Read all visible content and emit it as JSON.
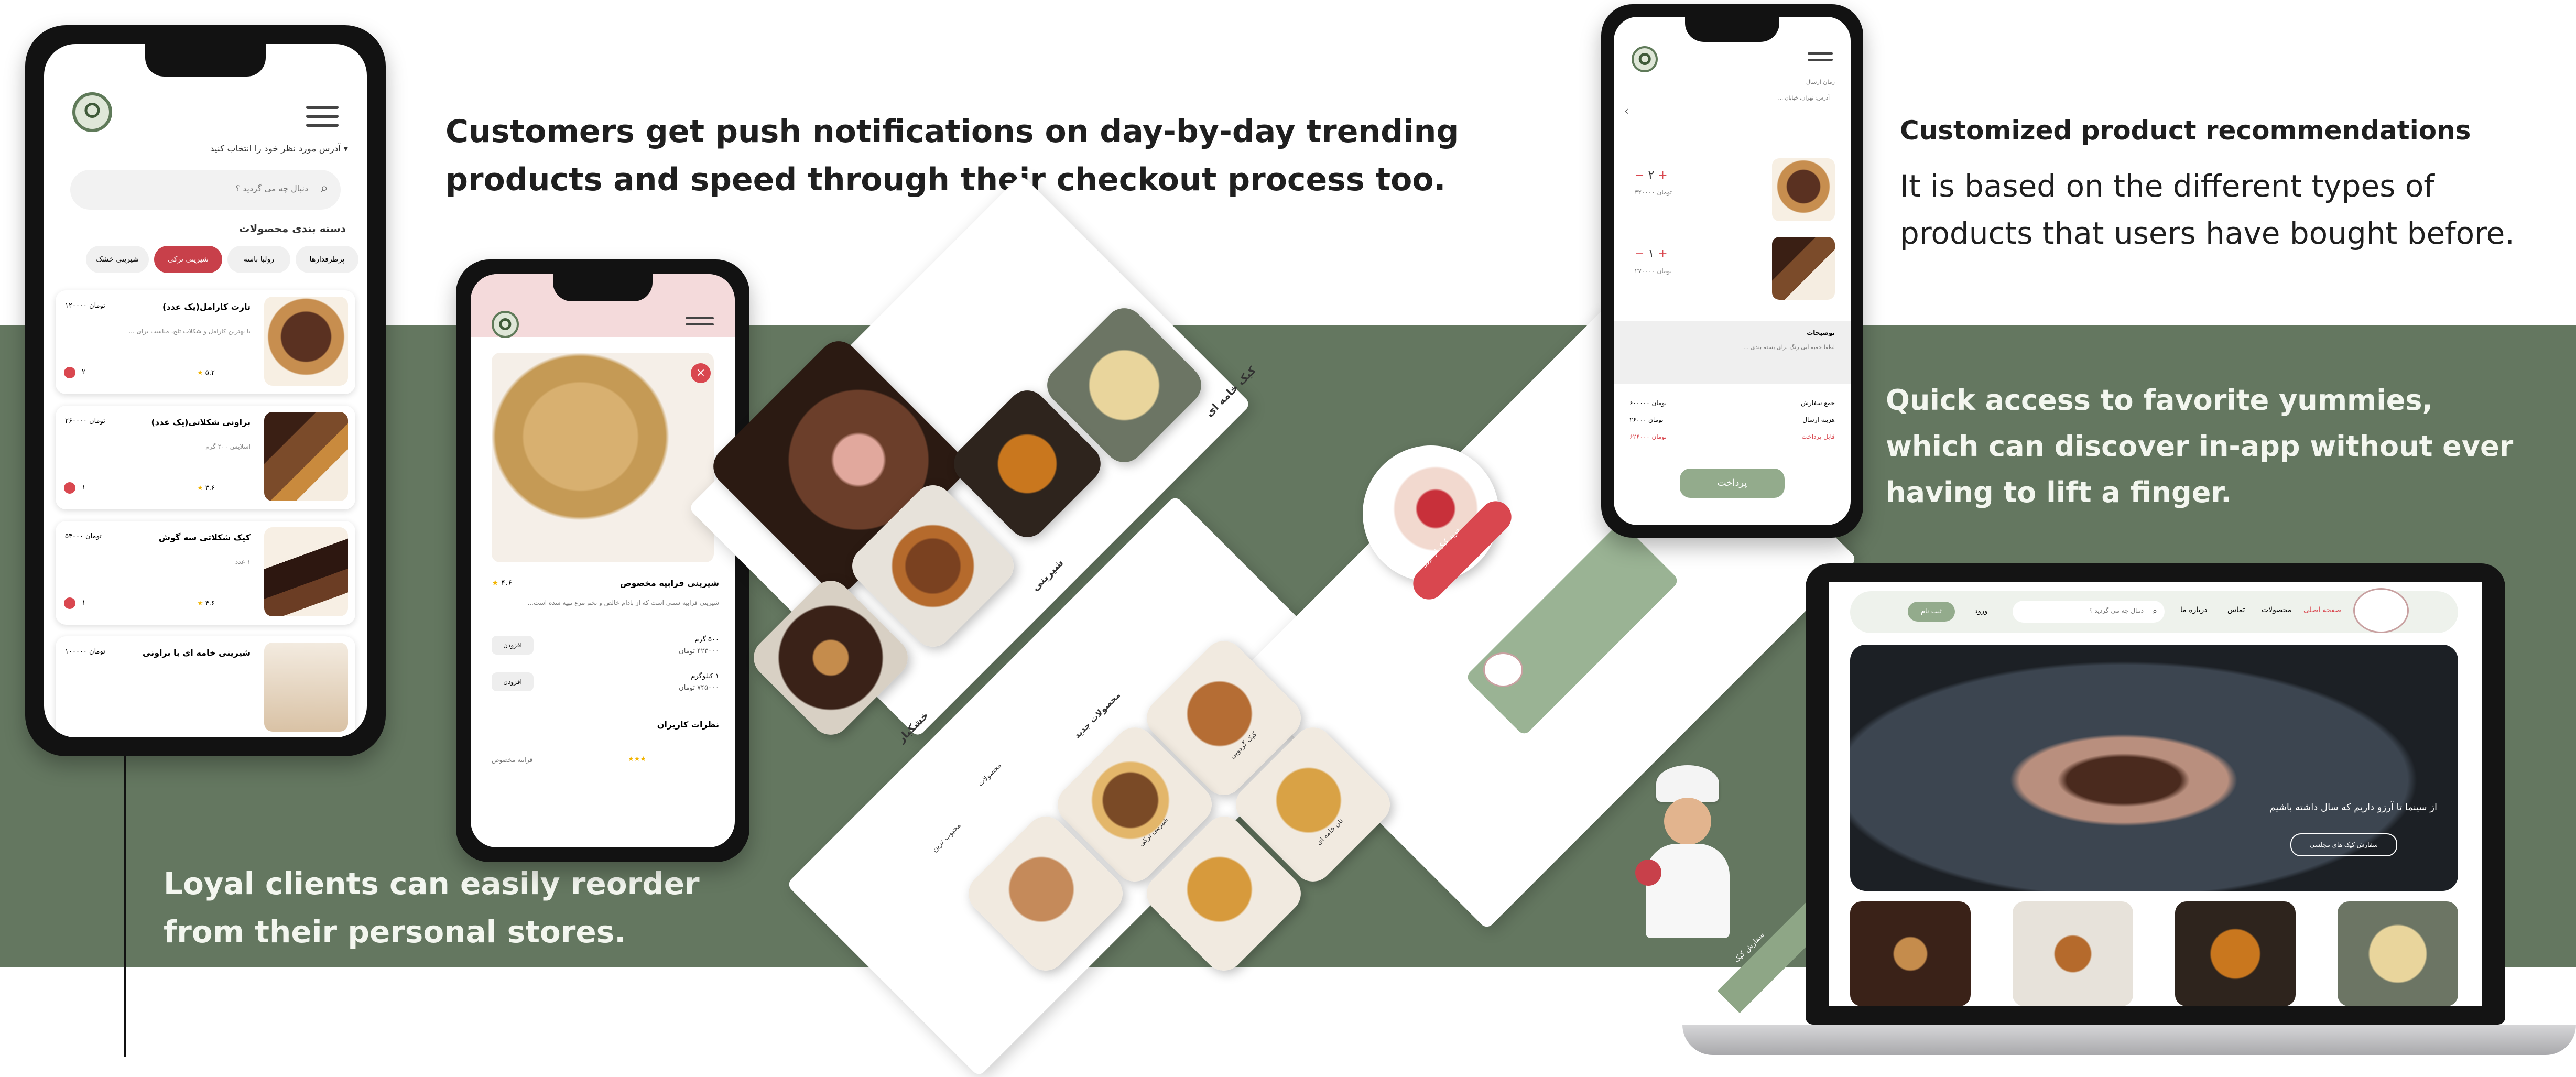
{
  "captions": {
    "push": "Customers get push notifications on day-by-day trending products and speed through their checkout process too.",
    "reco_title": "Customized product recommendations",
    "reco_body": "It is based on the different types of products that users have bought before.",
    "quick": "Quick access to favorite yummies, which can discover in-app without ever having to lift a finger.",
    "loyal": "Loyal clients can easily reorder from their personal stores."
  },
  "colors": {
    "band": "#647760",
    "accent_green": "#93ab8c",
    "accent_red": "#d9474f",
    "dark_green": "#3f5a39"
  },
  "phone1": {
    "address": "آدرس مورد نظر خود را انتخاب کنید",
    "search_placeholder": "دنبال چه می گردید ؟",
    "section_title": "دسته بندی محصولات",
    "categories": [
      "پرطرفدارها",
      "رولبا باسه",
      "شیرینی ترکی",
      "شیرینی خشک"
    ],
    "products": [
      {
        "name": "تارت کارامل(یک عدد)",
        "desc": "با بهترین کارامل و شکلات تلخ، مناسب برای ...",
        "price": "۱۲۰۰۰۰ تومان",
        "rating": "۵.۲",
        "qty": "۲"
      },
      {
        "name": "براونی شکلاتی(یک عدد)",
        "desc": "اسلایس ۲۰۰ گرم",
        "price": "۲۶۰۰۰۰ تومان",
        "rating": "۳.۶",
        "qty": "۱"
      },
      {
        "name": "کیک شکلاتی سه گوش",
        "desc": "۱ عدد",
        "price": "۵۴۰۰۰ تومان",
        "rating": "۴.۶",
        "qty": "۱"
      },
      {
        "name": "شیرینی خامه ای با براونی",
        "desc": "",
        "price": "۱۰۰۰۰۰ تومان",
        "rating": "",
        "qty": ""
      }
    ]
  },
  "phone2": {
    "product_name": "شیرینی قرابیه مخصوص",
    "rating": "۴.۶",
    "description": "شیرینی قرابیه سنتی است که از بادام خالص و تخم مرغ تهیه شده است...",
    "weight1": "۵۰۰ گرم",
    "price1": "۴۲۳۰۰۰ تومان",
    "weight2": "۱ کیلوگرم",
    "price2": "۷۴۵۰۰۰ تومان",
    "add_label": "افزودن",
    "comments_title": "نظرات کاربران",
    "commenter": "قرابیه مخصوص"
  },
  "phone3": {
    "delivery": "زمان ارسال",
    "address": "آدرس: تهران، خیابان ...",
    "items": [
      {
        "price": "۳۲۰۰۰۰ تومان",
        "qty": "۲"
      },
      {
        "price": "۲۷۰۰۰۰ تومان",
        "qty": "۱"
      }
    ],
    "notes_title": "توضیحات",
    "notes": "لطفا جعبه آبی رنگ برای بسته بندی ...",
    "summary": [
      {
        "label": "جمع سفارش",
        "value": "۶۰۰۰۰۰ تومان"
      },
      {
        "label": "هزینه ارسال",
        "value": "۲۶۰۰۰ تومان"
      },
      {
        "label": "قابل پرداخت",
        "value": "۶۲۶۰۰۰ تومان"
      }
    ],
    "pay_button": "پرداخت"
  },
  "tiles": {
    "left": [
      "کیک خامه ای",
      "شیرینی",
      "خشکبار"
    ],
    "middle": [
      "کیک گردویی",
      "نان خامه ای",
      "شیرینی ترکی"
    ],
    "middle_header": "محصولات جدید",
    "mid_side": [
      "محصولات",
      "محبوب ترین"
    ]
  },
  "laptop": {
    "nav": [
      "صفحه اصلی",
      "محصولات",
      "تماس",
      "درباره ما"
    ],
    "search_placeholder": "دنبال چه می گردید ؟",
    "login": "ورود",
    "signup": "ثبت نام",
    "hero_text": "از سینما تا آرزو داریم که سال داشته باشیم",
    "hero_button": "سفارش کیک های مجلسی"
  },
  "promo": {
    "card_text": "خرید کیک از آرزو",
    "banner": "سفارش کیک"
  }
}
